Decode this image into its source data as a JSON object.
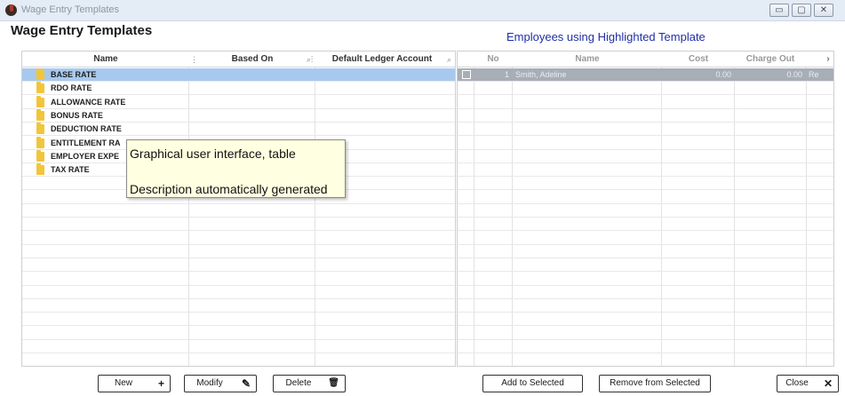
{
  "window": {
    "title": "Wage Entry Templates",
    "min_glyph": "▭",
    "max_glyph": "▢",
    "close_glyph": "✕"
  },
  "page": {
    "title": "Wage Entry Templates",
    "right_title": "Employees using Highlighted Template"
  },
  "templates_grid": {
    "columns": [
      {
        "label": "Name"
      },
      {
        "label": "Based On"
      },
      {
        "label": "Default Ledger Account"
      }
    ],
    "rows": [
      {
        "name": "BASE RATE",
        "selected": true
      },
      {
        "name": "RDO RATE",
        "selected": false
      },
      {
        "name": "ALLOWANCE RATE",
        "selected": false
      },
      {
        "name": "BONUS RATE",
        "selected": false
      },
      {
        "name": "DEDUCTION RATE",
        "selected": false
      },
      {
        "name": "ENTITLEMENT RA",
        "selected": false
      },
      {
        "name": "EMPLOYER EXPE",
        "selected": false
      },
      {
        "name": "TAX RATE",
        "selected": false
      }
    ]
  },
  "employees_grid": {
    "columns": [
      {
        "label": "No"
      },
      {
        "label": "Name"
      },
      {
        "label": "Cost"
      },
      {
        "label": "Charge Out"
      }
    ],
    "scroll_glyph": "›",
    "rows": [
      {
        "no": "1",
        "name": "Smith, Adeline",
        "cost": "0.00",
        "charge_out": "0.00",
        "extra": "Re",
        "selected": true
      }
    ]
  },
  "tooltip": {
    "line1": "Graphical user interface, table",
    "line2": "Description automatically generated"
  },
  "buttons": {
    "new": {
      "label": "New",
      "glyph": "+"
    },
    "modify": {
      "label": "Modify",
      "glyph": "✎"
    },
    "delete": {
      "label": "Delete",
      "glyph": "🗑"
    },
    "add_to_selected": {
      "label": "Add to Selected"
    },
    "remove_from_selected": {
      "label": "Remove from Selected"
    },
    "close": {
      "label": "Close",
      "glyph": "✕"
    }
  },
  "colors": {
    "selection": "#a7c9ee",
    "right_title": "#1f2ea8",
    "tooltip_bg": "#ffffe1"
  }
}
